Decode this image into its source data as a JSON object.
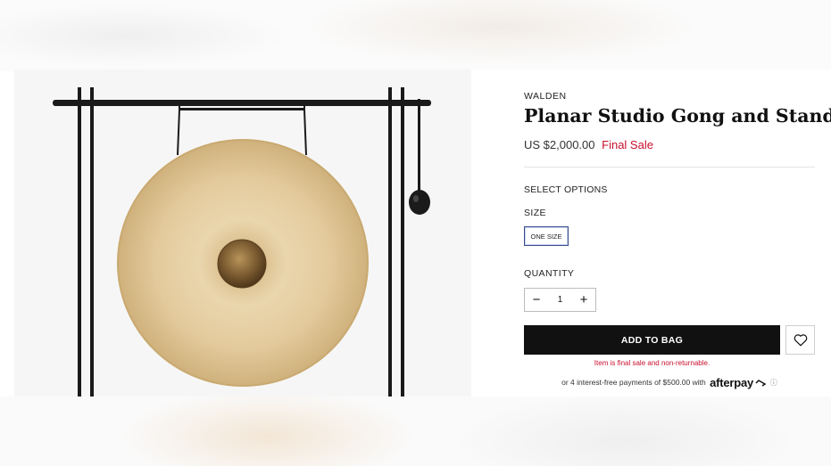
{
  "product": {
    "brand": "WALDEN",
    "title": "Planar Studio Gong and Stand",
    "price": "US $2,000.00",
    "sale_status": "Final Sale"
  },
  "options": {
    "header": "SELECT OPTIONS",
    "size_label": "SIZE",
    "size_selected": "ONE SIZE",
    "quantity_label": "QUANTITY",
    "quantity_value": "1",
    "minus_symbol": "−",
    "plus_symbol": "+"
  },
  "actions": {
    "add_to_bag": "ADD TO BAG",
    "wishlist_icon": "heart-icon"
  },
  "notice": "Item is final sale and non-returnable.",
  "afterpay": {
    "text": "or 4 interest-free payments of $500.00 with",
    "logo": "afterpay",
    "info_icon": "ⓘ"
  },
  "colors": {
    "accent_red": "#c8102e",
    "button_black": "#111111",
    "size_border": "#3b4e8c"
  }
}
